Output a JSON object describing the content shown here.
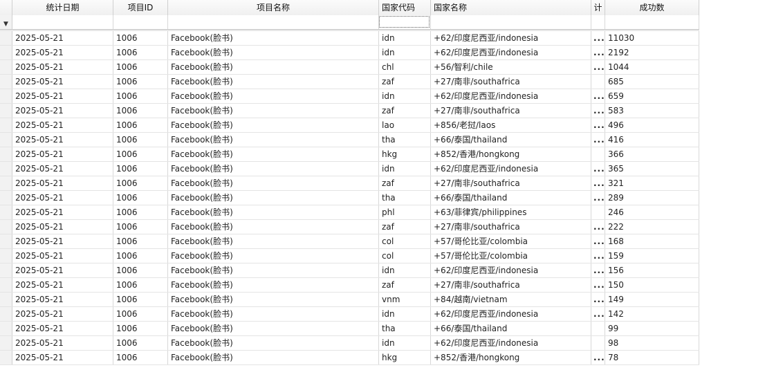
{
  "columns": {
    "date": "统计日期",
    "project_id": "项目ID",
    "project_name": "项目名称",
    "country_code": "国家代码",
    "country_name": "国家名称",
    "truncated": "计",
    "success_count": "成功数"
  },
  "filter_icon": "funnel-icon",
  "ellipsis": "...",
  "rows": [
    {
      "date": "2025-05-21",
      "project_id": "1006",
      "project_name": "Facebook(脸书)",
      "country_code": "idn",
      "country_name": "+62/印度尼西亚/indonesia",
      "dots": "...",
      "success_count": "11030"
    },
    {
      "date": "2025-05-21",
      "project_id": "1006",
      "project_name": "Facebook(脸书)",
      "country_code": "idn",
      "country_name": "+62/印度尼西亚/indonesia",
      "dots": "...",
      "success_count": "2192"
    },
    {
      "date": "2025-05-21",
      "project_id": "1006",
      "project_name": "Facebook(脸书)",
      "country_code": "chl",
      "country_name": "+56/智利/chile",
      "dots": "...",
      "success_count": "1044"
    },
    {
      "date": "2025-05-21",
      "project_id": "1006",
      "project_name": "Facebook(脸书)",
      "country_code": "zaf",
      "country_name": "+27/南非/southafrica",
      "dots": "",
      "success_count": "685"
    },
    {
      "date": "2025-05-21",
      "project_id": "1006",
      "project_name": "Facebook(脸书)",
      "country_code": "idn",
      "country_name": "+62/印度尼西亚/indonesia",
      "dots": "...",
      "success_count": "659"
    },
    {
      "date": "2025-05-21",
      "project_id": "1006",
      "project_name": "Facebook(脸书)",
      "country_code": "zaf",
      "country_name": "+27/南非/southafrica",
      "dots": "...",
      "success_count": "583"
    },
    {
      "date": "2025-05-21",
      "project_id": "1006",
      "project_name": "Facebook(脸书)",
      "country_code": "lao",
      "country_name": "+856/老挝/laos",
      "dots": "...",
      "success_count": "496"
    },
    {
      "date": "2025-05-21",
      "project_id": "1006",
      "project_name": "Facebook(脸书)",
      "country_code": "tha",
      "country_name": "+66/泰国/thailand",
      "dots": "...",
      "success_count": "416"
    },
    {
      "date": "2025-05-21",
      "project_id": "1006",
      "project_name": "Facebook(脸书)",
      "country_code": "hkg",
      "country_name": "+852/香港/hongkong",
      "dots": "",
      "success_count": "366"
    },
    {
      "date": "2025-05-21",
      "project_id": "1006",
      "project_name": "Facebook(脸书)",
      "country_code": "idn",
      "country_name": "+62/印度尼西亚/indonesia",
      "dots": "...",
      "success_count": "365"
    },
    {
      "date": "2025-05-21",
      "project_id": "1006",
      "project_name": "Facebook(脸书)",
      "country_code": "zaf",
      "country_name": "+27/南非/southafrica",
      "dots": "...",
      "success_count": "321"
    },
    {
      "date": "2025-05-21",
      "project_id": "1006",
      "project_name": "Facebook(脸书)",
      "country_code": "tha",
      "country_name": "+66/泰国/thailand",
      "dots": "...",
      "success_count": "289"
    },
    {
      "date": "2025-05-21",
      "project_id": "1006",
      "project_name": "Facebook(脸书)",
      "country_code": "phl",
      "country_name": "+63/菲律宾/philippines",
      "dots": "",
      "success_count": "246"
    },
    {
      "date": "2025-05-21",
      "project_id": "1006",
      "project_name": "Facebook(脸书)",
      "country_code": "zaf",
      "country_name": "+27/南非/southafrica",
      "dots": "...",
      "success_count": "222"
    },
    {
      "date": "2025-05-21",
      "project_id": "1006",
      "project_name": "Facebook(脸书)",
      "country_code": "col",
      "country_name": "+57/哥伦比亚/colombia",
      "dots": "...",
      "success_count": "168"
    },
    {
      "date": "2025-05-21",
      "project_id": "1006",
      "project_name": "Facebook(脸书)",
      "country_code": "col",
      "country_name": "+57/哥伦比亚/colombia",
      "dots": "...",
      "success_count": "159"
    },
    {
      "date": "2025-05-21",
      "project_id": "1006",
      "project_name": "Facebook(脸书)",
      "country_code": "idn",
      "country_name": "+62/印度尼西亚/indonesia",
      "dots": "...",
      "success_count": "156"
    },
    {
      "date": "2025-05-21",
      "project_id": "1006",
      "project_name": "Facebook(脸书)",
      "country_code": "zaf",
      "country_name": "+27/南非/southafrica",
      "dots": "...",
      "success_count": "150"
    },
    {
      "date": "2025-05-21",
      "project_id": "1006",
      "project_name": "Facebook(脸书)",
      "country_code": "vnm",
      "country_name": "+84/越南/vietnam",
      "dots": "...",
      "success_count": "149"
    },
    {
      "date": "2025-05-21",
      "project_id": "1006",
      "project_name": "Facebook(脸书)",
      "country_code": "idn",
      "country_name": "+62/印度尼西亚/indonesia",
      "dots": "...",
      "success_count": "142"
    },
    {
      "date": "2025-05-21",
      "project_id": "1006",
      "project_name": "Facebook(脸书)",
      "country_code": "tha",
      "country_name": "+66/泰国/thailand",
      "dots": "",
      "success_count": "99"
    },
    {
      "date": "2025-05-21",
      "project_id": "1006",
      "project_name": "Facebook(脸书)",
      "country_code": "idn",
      "country_name": "+62/印度尼西亚/indonesia",
      "dots": "",
      "success_count": "98"
    },
    {
      "date": "2025-05-21",
      "project_id": "1006",
      "project_name": "Facebook(脸书)",
      "country_code": "hkg",
      "country_name": "+852/香港/hongkong",
      "dots": "...",
      "success_count": "78"
    }
  ]
}
